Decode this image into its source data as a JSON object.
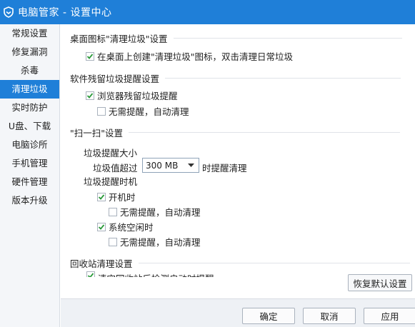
{
  "window": {
    "title": "电脑管家 - 设置中心",
    "accent": "#1f7fd8"
  },
  "sidebar": {
    "items": [
      {
        "label": "常规设置"
      },
      {
        "label": "修复漏洞"
      },
      {
        "label": "杀毒"
      },
      {
        "label": "清理垃圾",
        "active": true
      },
      {
        "label": "实时防护"
      },
      {
        "label": "U盘、下载"
      },
      {
        "label": "电脑诊所"
      },
      {
        "label": "手机管理"
      },
      {
        "label": "硬件管理"
      },
      {
        "label": "版本升级"
      }
    ]
  },
  "desktop_icon": {
    "title": "桌面图标\"清理垃圾\"设置",
    "create_icon": {
      "label": "在桌面上创建\"清理垃圾\"图标，双击清理日常垃圾",
      "checked": true
    }
  },
  "residual": {
    "title": "软件残留垃圾提醒设置",
    "browser_residual": {
      "label": "浏览器残留垃圾提醒",
      "checked": true
    },
    "auto_clean": {
      "label": "无需提醒，自动清理",
      "checked": false
    }
  },
  "scan": {
    "title": "\"扫一扫\"设置",
    "size_label": "垃圾提醒大小",
    "threshold_prefix": "垃圾值超过",
    "threshold_value": "300 MB",
    "threshold_suffix": "时提醒清理",
    "timing_label": "垃圾提醒时机",
    "on_boot": {
      "label": "开机时",
      "checked": true
    },
    "on_boot_auto": {
      "label": "无需提醒，自动清理",
      "checked": false
    },
    "on_idle": {
      "label": "系统空闲时",
      "checked": true
    },
    "on_idle_auto": {
      "label": "无需提醒，自动清理",
      "checked": false
    }
  },
  "recycle": {
    "title": "回收站清理设置",
    "cut_text": "清空回收站后检测启动时提醒"
  },
  "buttons": {
    "restore": "恢复默认设置",
    "ok": "确定",
    "cancel": "取消",
    "apply": "应用"
  }
}
